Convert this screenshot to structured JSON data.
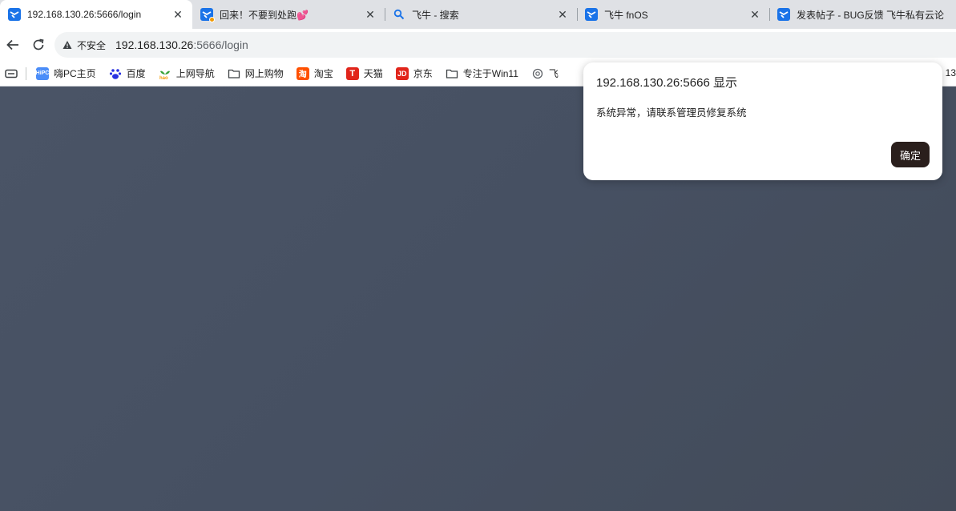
{
  "tabs": [
    {
      "title": "192.168.130.26:5666/login",
      "icon": "fnos-logo-icon",
      "active": true
    },
    {
      "title": "回来！不要到处跑💕",
      "icon": "fnos-logo-icon",
      "active": false
    },
    {
      "title": "飞牛 - 搜索",
      "icon": "search-icon",
      "active": false
    },
    {
      "title": "飞牛 fnOS",
      "icon": "fnos-logo-icon",
      "active": false
    },
    {
      "title": "发表帖子 - BUG反馈 飞牛私有云论",
      "icon": "fnos-logo-icon",
      "active": false
    }
  ],
  "address": {
    "security_label": "不安全",
    "url_host": "192.168.130.26",
    "url_rest": ":5666/login"
  },
  "bookmarks": [
    {
      "label": "嗨PC主页",
      "icon": "hipc-icon",
      "color": "#4b8df8"
    },
    {
      "label": "百度",
      "icon": "baidu-icon",
      "color": "#2932e1"
    },
    {
      "label": "上网导航",
      "icon": "hao-icon",
      "color": "#3aa33a"
    },
    {
      "label": "网上购物",
      "icon": "folder-icon",
      "color": "#5f6368"
    },
    {
      "label": "淘宝",
      "icon": "taobao-icon",
      "color": "#ff5000"
    },
    {
      "label": "天猫",
      "icon": "tmall-icon",
      "color": "#e1251b"
    },
    {
      "label": "京东",
      "icon": "jd-icon",
      "color": "#e1251b"
    },
    {
      "label": "专注于Win11",
      "icon": "folder-icon",
      "color": "#5f6368"
    },
    {
      "label": "飞",
      "icon": "chatgpt-icon",
      "color": "#5f6368"
    }
  ],
  "bookmarks_trailing": "13",
  "dialog": {
    "title": "192.168.130.26:5666 显示",
    "message": "系统异常，请联系管理员修复系统",
    "ok_label": "确定"
  }
}
